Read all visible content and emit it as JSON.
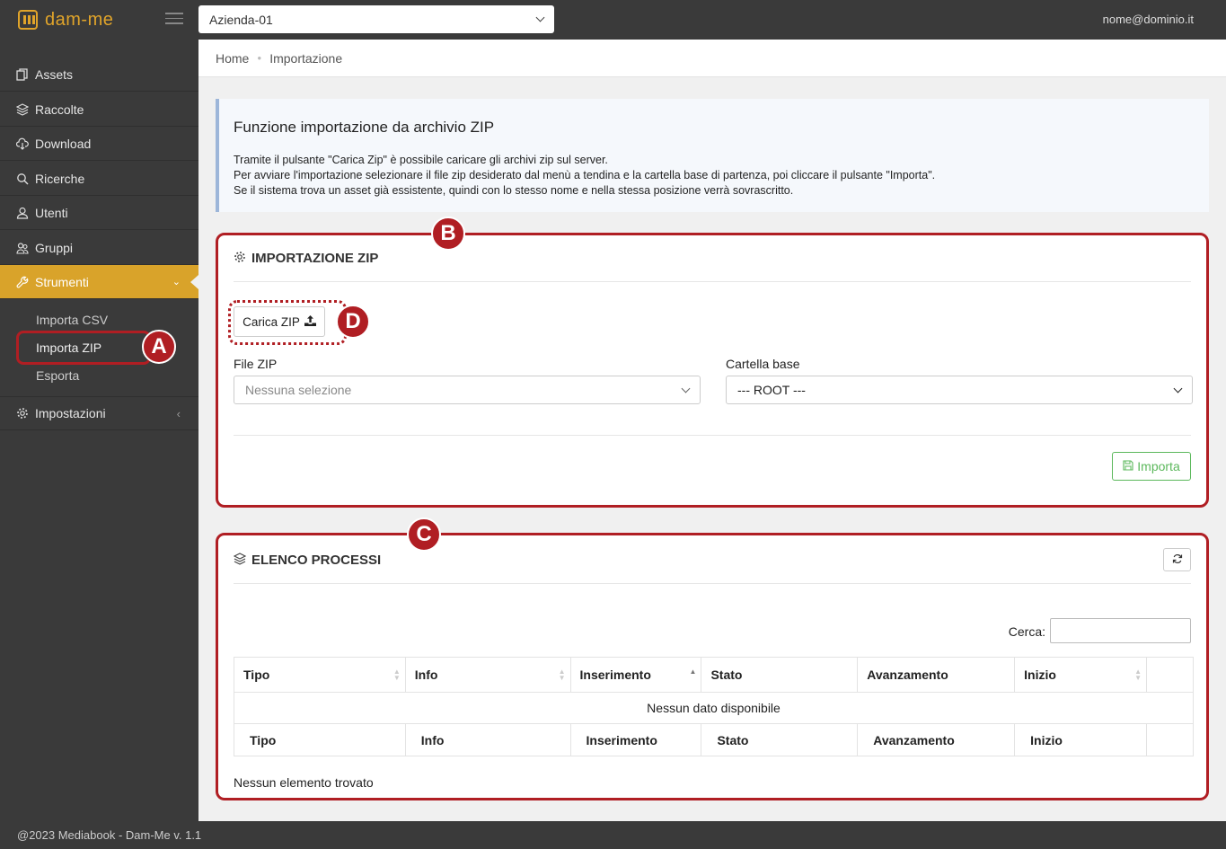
{
  "app": {
    "logo_text": "dam-me",
    "company_selected": "Azienda-01",
    "user_email": "nome@dominio.it",
    "footer": "@2023 Mediabook - Dam-Me v. 1.1"
  },
  "breadcrumb": [
    "Home",
    "Importazione"
  ],
  "sidebar": {
    "items": [
      {
        "label": "Assets",
        "icon": "assets-icon"
      },
      {
        "label": "Raccolte",
        "icon": "layers-icon"
      },
      {
        "label": "Download",
        "icon": "cloud-download-icon"
      },
      {
        "label": "Ricerche",
        "icon": "search-icon"
      },
      {
        "label": "Utenti",
        "icon": "user-icon"
      },
      {
        "label": "Gruppi",
        "icon": "group-icon"
      },
      {
        "label": "Strumenti",
        "icon": "wrench-icon"
      },
      {
        "label": "Impostazioni",
        "icon": "gear-icon"
      }
    ],
    "submenu": [
      "Importa CSV",
      "Importa ZIP",
      "Esporta"
    ]
  },
  "info": {
    "title": "Funzione importazione da archivio ZIP",
    "lines": [
      "Tramite il pulsante \"Carica Zip\" è possibile caricare gli archivi zip sul server.",
      "Per avviare l'importazione selezionare il file zip desiderato dal menù a tendina e la cartella base di partenza, poi cliccare il pulsante \"Importa\".",
      "Se il sistema trova un asset già essistente, quindi con lo stesso nome e nella stessa posizione verrà sovrascritto."
    ]
  },
  "import_panel": {
    "title": "IMPORTAZIONE ZIP",
    "upload_label": "Carica ZIP",
    "file_label": "File ZIP",
    "file_placeholder": "Nessuna selezione",
    "folder_label": "Cartella base",
    "folder_value": "--- ROOT ---",
    "import_label": "Importa"
  },
  "process_panel": {
    "title": "ELENCO PROCESSI",
    "search_label": "Cerca:",
    "columns": [
      "Tipo",
      "Info",
      "Inserimento",
      "Stato",
      "Avanzamento",
      "Inizio"
    ],
    "empty_row": "Nessun dato disponibile",
    "footer_info": "Nessun elemento trovato"
  },
  "annotations": [
    "A",
    "B",
    "C",
    "D"
  ],
  "colors": {
    "accent": "#d9a32a",
    "annotation": "#b01e23",
    "success": "#5cb85c",
    "sidebar_bg": "#3a3a3a"
  }
}
